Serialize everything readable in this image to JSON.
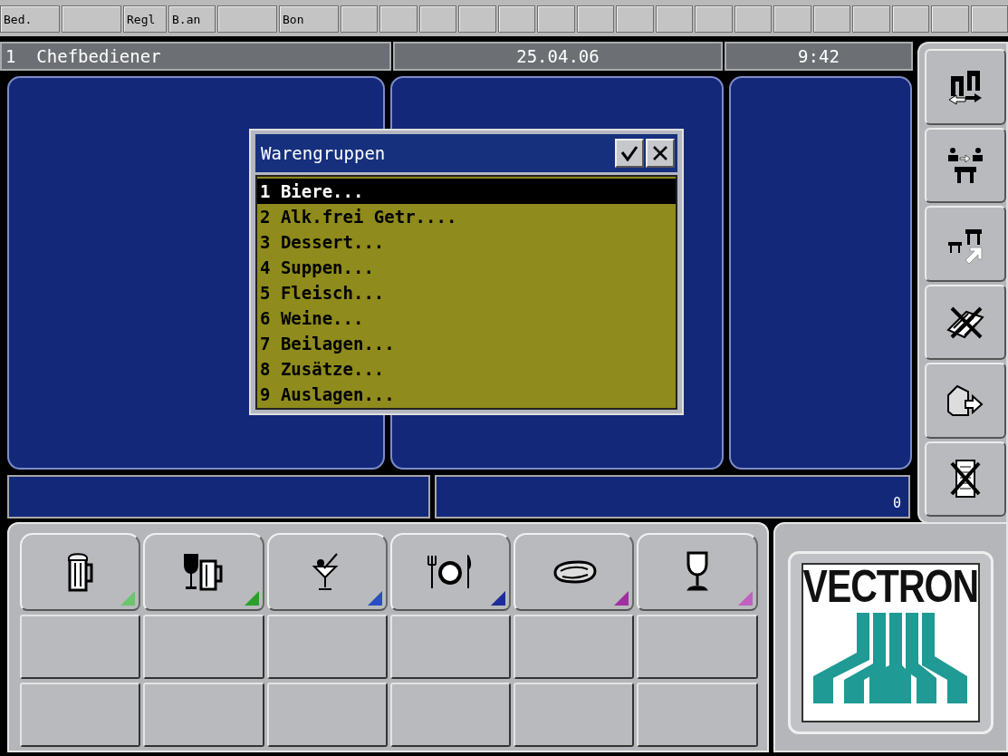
{
  "top_bar": [
    {
      "kind": "text",
      "label": "Bed."
    },
    {
      "kind": "blank"
    },
    {
      "kind": "text",
      "label": "Regl"
    },
    {
      "kind": "text",
      "label": "B.an"
    },
    {
      "kind": "blank"
    },
    {
      "kind": "text",
      "label": "Bon"
    },
    {
      "kind": "blank"
    },
    {
      "kind": "blank"
    },
    {
      "kind": "blank"
    },
    {
      "kind": "blank"
    },
    {
      "kind": "blank"
    },
    {
      "kind": "blank"
    },
    {
      "kind": "blank"
    },
    {
      "kind": "blank"
    },
    {
      "kind": "blank"
    },
    {
      "kind": "blank"
    },
    {
      "kind": "blank"
    },
    {
      "kind": "blank"
    },
    {
      "kind": "blank"
    },
    {
      "kind": "blank"
    },
    {
      "kind": "blank"
    },
    {
      "kind": "blank"
    },
    {
      "kind": "blank"
    }
  ],
  "header": {
    "operator": "1  Chefbediener",
    "date": "25.04.06",
    "time": "9:42"
  },
  "dialog": {
    "title": "Warengruppen",
    "items": [
      {
        "label": "1 Biere...",
        "selected": true
      },
      {
        "label": "2 Alk.frei Getr....",
        "selected": false
      },
      {
        "label": "3 Dessert...",
        "selected": false
      },
      {
        "label": "4 Suppen...",
        "selected": false
      },
      {
        "label": "5 Fleisch...",
        "selected": false
      },
      {
        "label": "6 Weine...",
        "selected": false
      },
      {
        "label": "7 Beilagen...",
        "selected": false
      },
      {
        "label": "8 Zusätze...",
        "selected": false
      },
      {
        "label": "9 Auslagen...",
        "selected": false
      }
    ]
  },
  "total": "0",
  "side_buttons": [
    {
      "kind": "swap"
    },
    {
      "kind": "transfer"
    },
    {
      "kind": "move"
    },
    {
      "kind": "cancel"
    },
    {
      "kind": "exit"
    },
    {
      "kind": "void"
    }
  ],
  "category_keys": [
    {
      "kind": "beer",
      "color": "#6cc46c"
    },
    {
      "kind": "drinks",
      "color": "#2aa02a"
    },
    {
      "kind": "cocktail",
      "color": "#2a4ec0"
    },
    {
      "kind": "plate",
      "color": "#1c2c9a"
    },
    {
      "kind": "steak",
      "color": "#a030a0"
    },
    {
      "kind": "wine",
      "color": "#c060c0"
    }
  ],
  "logo": {
    "text": "VECTRON"
  }
}
